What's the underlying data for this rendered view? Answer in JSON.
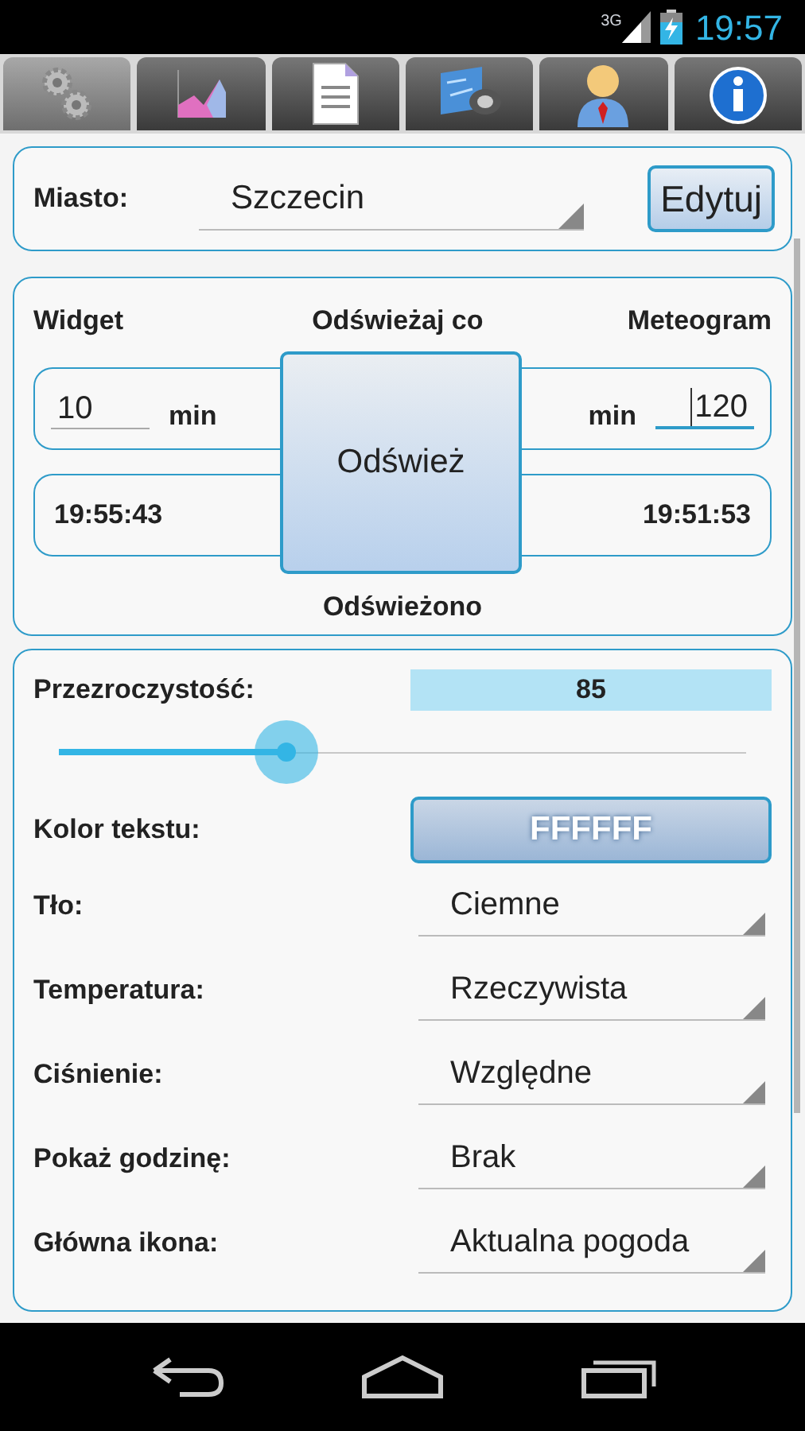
{
  "status_bar": {
    "network": "3G",
    "time": "19:57"
  },
  "tabs": [
    {
      "kind": "gears",
      "selected": true
    },
    {
      "kind": "chart",
      "selected": false
    },
    {
      "kind": "document",
      "selected": false
    },
    {
      "kind": "map",
      "selected": false
    },
    {
      "kind": "person",
      "selected": false
    },
    {
      "kind": "info",
      "selected": false
    }
  ],
  "city": {
    "label": "Miasto:",
    "value": "Szczecin",
    "button": "Edytuj"
  },
  "refresh": {
    "widget_label": "Widget",
    "interval_label": "Odświeżaj co",
    "meteogram_label": "Meteogram",
    "widget_interval": {
      "value": "10",
      "focused": false
    },
    "widget_unit": "min",
    "meteogram_unit": "min",
    "meteogram_interval": {
      "value": "120",
      "focused": true
    },
    "button": "Odśwież",
    "widget_time": "19:55:43",
    "meteogram_time": "19:51:53",
    "refreshed_label": "Odświeżono"
  },
  "appearance": {
    "opacity_label": "Przezroczystość:",
    "opacity_value": "85",
    "level": 0.33,
    "text_color_label": "Kolor tekstu:",
    "text_color_button": "FFFFFF",
    "settings": [
      {
        "label": "Tło:",
        "value": "Ciemne"
      },
      {
        "label": "Temperatura:",
        "value": "Rzeczywista"
      },
      {
        "label": "Ciśnienie:",
        "value": "Względne"
      },
      {
        "label": "Pokaż godzinę:",
        "value": "Brak"
      },
      {
        "label": "Główna ikona:",
        "value": "Aktualna pogoda"
      }
    ]
  }
}
